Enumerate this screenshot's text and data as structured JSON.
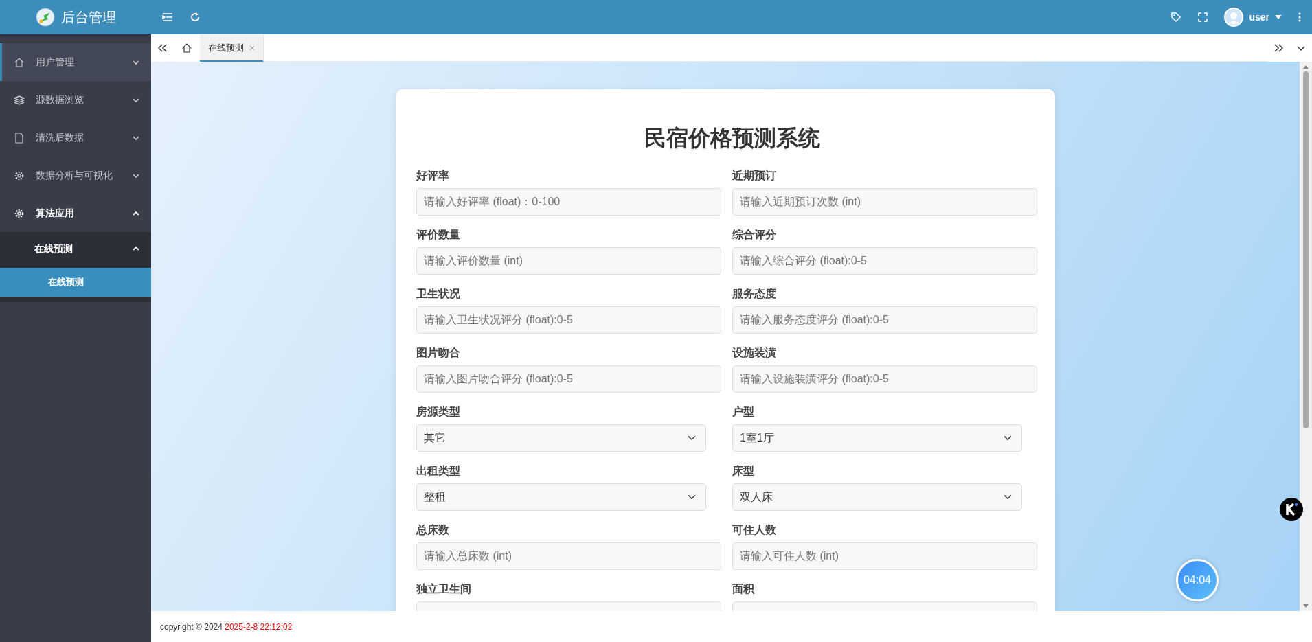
{
  "header": {
    "title": "后台管理",
    "user": "user"
  },
  "sidebar": {
    "items": [
      {
        "label": "用户管理",
        "selected": true,
        "expanded": false
      },
      {
        "label": "源数据浏览",
        "selected": false,
        "expanded": false
      },
      {
        "label": "清洗后数据",
        "selected": false,
        "expanded": false
      },
      {
        "label": "数据分析与可视化",
        "selected": false,
        "expanded": false
      },
      {
        "label": "算法应用",
        "selected": false,
        "expanded": true,
        "children": [
          {
            "label": "在线预测",
            "selected": false,
            "expanded": true,
            "children": [
              {
                "label": "在线预测",
                "selected": true
              }
            ]
          }
        ]
      }
    ]
  },
  "tabs": [
    {
      "label": "在线预测",
      "selected": true
    }
  ],
  "form": {
    "title": "民宿价格预测系统",
    "fields": [
      {
        "label": "好评率",
        "kind": "input",
        "placeholder": "请输入好评率 (float)：0-100"
      },
      {
        "label": "近期预订",
        "kind": "input",
        "placeholder": "请输入近期预订次数 (int)"
      },
      {
        "label": "评价数量",
        "kind": "input",
        "placeholder": "请输入评价数量 (int)"
      },
      {
        "label": "综合评分",
        "kind": "input",
        "placeholder": "请输入综合评分 (float):0-5"
      },
      {
        "label": "卫生状况",
        "kind": "input",
        "placeholder": "请输入卫生状况评分 (float):0-5"
      },
      {
        "label": "服务态度",
        "kind": "input",
        "placeholder": "请输入服务态度评分 (float):0-5"
      },
      {
        "label": "图片吻合",
        "kind": "input",
        "placeholder": "请输入图片吻合评分 (float):0-5"
      },
      {
        "label": "设施装潢",
        "kind": "input",
        "placeholder": "请输入设施装潢评分 (float):0-5"
      },
      {
        "label": "房源类型",
        "kind": "select",
        "value": "其它"
      },
      {
        "label": "户型",
        "kind": "select",
        "value": "1室1厅"
      },
      {
        "label": "出租类型",
        "kind": "select",
        "value": "整租"
      },
      {
        "label": "床型",
        "kind": "select",
        "value": "双人床"
      },
      {
        "label": "总床数",
        "kind": "input",
        "placeholder": "请输入总床数 (int)"
      },
      {
        "label": "可住人数",
        "kind": "input",
        "placeholder": "请输入可住人数 (int)"
      },
      {
        "label": "独立卫生间",
        "kind": "input"
      },
      {
        "label": "面积",
        "kind": "input"
      }
    ]
  },
  "timer": "04:04",
  "footer": {
    "copyright": "copyright © 2024",
    "datetime": "2025-2-8 22:12:02"
  }
}
